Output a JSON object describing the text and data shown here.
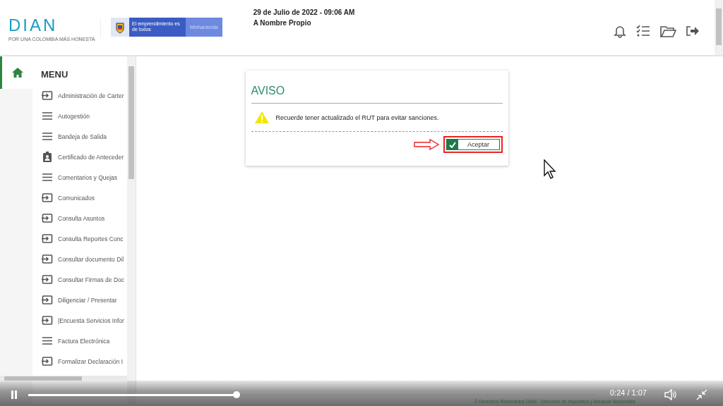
{
  "header": {
    "logo": "DIAN",
    "tagline": "POR UNA COLOMBIA MÁS HONESTA",
    "banner_text": "El emprendimiento es de todos",
    "banner_ministry": "Minhacienda",
    "date": "29 de Julio de 2022 - 09:06 AM",
    "user_mode": "A Nombre Propio"
  },
  "sidebar": {
    "title": "MENU",
    "items": [
      {
        "label": "Administración de Carter",
        "kind": "enter"
      },
      {
        "label": "Autogestión",
        "kind": "list"
      },
      {
        "label": "Bandeja de Salida",
        "kind": "list"
      },
      {
        "label": "Certificado de Anteceder",
        "kind": "badge"
      },
      {
        "label": "Comentarios y Quejas",
        "kind": "list"
      },
      {
        "label": "Comunicados",
        "kind": "enter"
      },
      {
        "label": "Consulta Asuntos",
        "kind": "enter"
      },
      {
        "label": "Consulta Reportes Conc",
        "kind": "enter"
      },
      {
        "label": "Consultar documento Dil",
        "kind": "enter"
      },
      {
        "label": "Consultar Firmas de Doc",
        "kind": "enter"
      },
      {
        "label": "Diligenciar / Presentar",
        "kind": "enter"
      },
      {
        "label": "|Encuesta Servicios Infor",
        "kind": "enter"
      },
      {
        "label": "Factura Electrónica",
        "kind": "list"
      },
      {
        "label": "Formalizar Declaración I",
        "kind": "enter"
      }
    ]
  },
  "dialog": {
    "title": "AVISO",
    "message": "Recuerde tener actualizado el RUT para evitar sanciones.",
    "button": "Aceptar"
  },
  "footer": "© Derechos Reservados DIAN - Dirección de Impuestos y Aduanas Nacionales",
  "player": {
    "playing": true,
    "level": 0.367,
    "time": "0:24 / 1:07"
  }
}
